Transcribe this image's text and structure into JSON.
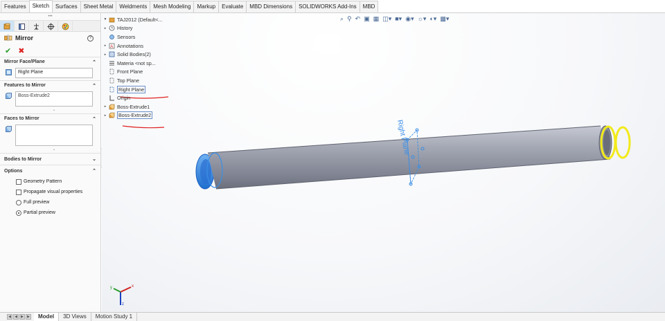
{
  "command_tabs": [
    {
      "label": "Features",
      "active": false
    },
    {
      "label": "Sketch",
      "active": true
    },
    {
      "label": "Surfaces",
      "active": false
    },
    {
      "label": "Sheet Metal",
      "active": false
    },
    {
      "label": "Weldments",
      "active": false
    },
    {
      "label": "Mesh Modeling",
      "active": false
    },
    {
      "label": "Markup",
      "active": false
    },
    {
      "label": "Evaluate",
      "active": false
    },
    {
      "label": "MBD Dimensions",
      "active": false
    },
    {
      "label": "SOLIDWORKS Add-Ins",
      "active": false
    },
    {
      "label": "MBD",
      "active": false
    }
  ],
  "property_manager": {
    "title": "Mirror",
    "mirror_face": {
      "header": "Mirror Face/Plane",
      "value": "Right Plane"
    },
    "features": {
      "header": "Features to Mirror",
      "items": [
        "Boss-Extrude2"
      ]
    },
    "faces": {
      "header": "Faces to Mirror"
    },
    "bodies": {
      "header": "Bodies to Mirror"
    },
    "options": {
      "header": "Options",
      "geometry_pattern": "Geometry Pattern",
      "propagate": "Propagate visual properties",
      "full_preview": "Full preview",
      "partial_preview": "Partial preview"
    }
  },
  "feature_tree": {
    "part": "TAJ2012  (Default<...",
    "items": {
      "history": "History",
      "sensors": "Sensors",
      "annotations": "Annotations",
      "solid_bodies": "Solid Bodies(2)",
      "material": "Materia <not sp...",
      "front_plane": "Front Plane",
      "top_plane": "Top Plane",
      "right_plane": "Right Plane",
      "origin": "Origin",
      "boss1": "Boss-Extrude1",
      "boss2": "Boss-Extrude2"
    }
  },
  "viewport": {
    "plane_label": "Right Plane",
    "triad": {
      "x": "x",
      "y": "y",
      "z": "z"
    }
  },
  "bottom_tabs": [
    {
      "label": "Model",
      "active": true
    },
    {
      "label": "3D Views",
      "active": false
    },
    {
      "label": "Motion Study 1",
      "active": false
    }
  ],
  "colors": {
    "selection_blue": "#3a8ee6",
    "mirror_yellow": "#f2ea1a",
    "markup_red": "#e02020",
    "tube_gray": "#9ba0ad"
  }
}
